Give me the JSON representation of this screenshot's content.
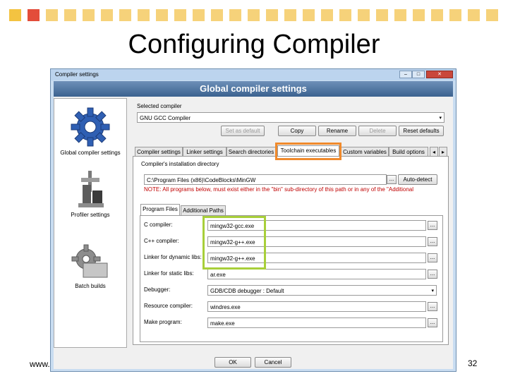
{
  "slide": {
    "title": "Configuring Compiler",
    "footer_url": "www.",
    "page_number": "32",
    "squares": [
      {
        "color": "#f3c341"
      },
      {
        "color": "#e34d3a"
      },
      {
        "color": "#f6d27a"
      },
      {
        "color": "#f6d27a"
      },
      {
        "color": "#f6d27a"
      },
      {
        "color": "#f6d27a"
      },
      {
        "color": "#f6d27a"
      },
      {
        "color": "#f6d27a"
      },
      {
        "color": "#f6d27a"
      },
      {
        "color": "#f6d27a"
      },
      {
        "color": "#f6d27a"
      },
      {
        "color": "#f6d27a"
      },
      {
        "color": "#f6d27a"
      },
      {
        "color": "#f6d27a"
      },
      {
        "color": "#f6d27a"
      },
      {
        "color": "#f6d27a"
      },
      {
        "color": "#f6d27a"
      },
      {
        "color": "#f6d27a"
      },
      {
        "color": "#f6d27a"
      },
      {
        "color": "#f6d27a"
      },
      {
        "color": "#f6d27a"
      },
      {
        "color": "#f6d27a"
      },
      {
        "color": "#f6d27a"
      },
      {
        "color": "#f6d27a"
      },
      {
        "color": "#f6d27a"
      },
      {
        "color": "#f6d27a"
      },
      {
        "color": "#f6d27a"
      }
    ]
  },
  "window": {
    "title": "Compiler settings",
    "banner": "Global compiler settings",
    "controls": {
      "minimize": "–",
      "maximize": "□",
      "close": "✕"
    }
  },
  "sidebar": {
    "items": [
      {
        "label": "Global compiler settings",
        "icon": "gear-icon"
      },
      {
        "label": "Profiler settings",
        "icon": "profiler-icon"
      },
      {
        "label": "Batch builds",
        "icon": "batch-gear-icon"
      }
    ]
  },
  "compiler": {
    "selected_label": "Selected compiler",
    "selected_value": "GNU GCC Compiler",
    "buttons": {
      "set_default": "Set as default",
      "copy": "Copy",
      "rename": "Rename",
      "delete": "Delete",
      "reset": "Reset defaults"
    }
  },
  "tabs": [
    {
      "label": "Compiler settings"
    },
    {
      "label": "Linker settings"
    },
    {
      "label": "Search directories"
    },
    {
      "label": "Toolchain executables"
    },
    {
      "label": "Custom variables"
    },
    {
      "label": "Build options"
    }
  ],
  "tab_scroll": {
    "left": "◂",
    "right": "▸"
  },
  "toolchain": {
    "install_dir_label": "Compiler's installation directory",
    "install_dir_value": "C:\\Program Files (x86)\\CodeBlocks\\MinGW",
    "browse": "...",
    "auto_detect": "Auto-detect",
    "note": "NOTE: All programs below, must exist either in the \"bin\" sub-directory of this path or in any of the \"Additional",
    "sub_tabs": [
      {
        "label": "Program Files"
      },
      {
        "label": "Additional Paths"
      }
    ],
    "programs": [
      {
        "label": "C compiler:",
        "value": "mingw32-gcc.exe"
      },
      {
        "label": "C++ compiler:",
        "value": "mingw32-g++.exe"
      },
      {
        "label": "Linker for dynamic libs:",
        "value": "mingw32-g++.exe"
      },
      {
        "label": "Linker for static libs:",
        "value": "ar.exe"
      },
      {
        "label": "Debugger:",
        "value": "GDB/CDB debugger : Default"
      },
      {
        "label": "Resource compiler:",
        "value": "windres.exe"
      },
      {
        "label": "Make program:",
        "value": "make.exe"
      }
    ]
  },
  "dialog_buttons": {
    "ok": "OK",
    "cancel": "Cancel"
  },
  "highlight_colors": {
    "tab": "#f08a2c",
    "programs": "#a8cf3a"
  }
}
